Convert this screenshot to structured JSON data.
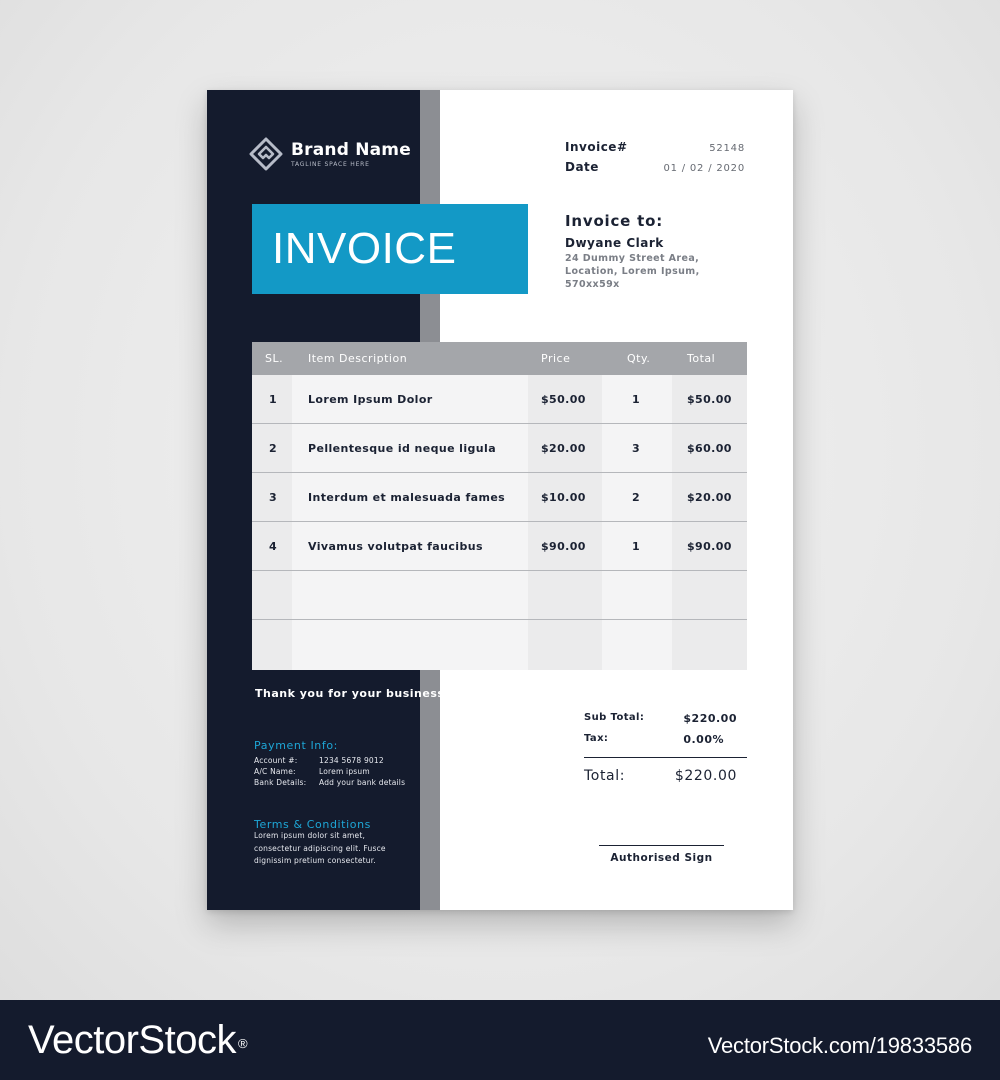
{
  "brand": {
    "name": "Brand Name",
    "tagline": "TAGLINE SPACE HERE"
  },
  "banner": {
    "title": "INVOICE"
  },
  "meta": {
    "invoice_label": "Invoice#",
    "invoice_number": "52148",
    "date_label": "Date",
    "date_value": "01 / 02 / 2020"
  },
  "recipient": {
    "title": "Invoice to:",
    "name": "Dwyane Clark",
    "address_lines": [
      "24 Dummy Street Area,",
      "Location, Lorem Ipsum,",
      "570xx59x"
    ]
  },
  "table": {
    "headers": [
      "SL.",
      "Item Description",
      "Price",
      "Qty.",
      "Total"
    ],
    "rows": [
      {
        "sl": "1",
        "desc": "Lorem Ipsum Dolor",
        "price": "$50.00",
        "qty": "1",
        "total": "$50.00"
      },
      {
        "sl": "2",
        "desc": "Pellentesque id neque ligula",
        "price": "$20.00",
        "qty": "3",
        "total": "$60.00"
      },
      {
        "sl": "3",
        "desc": "Interdum et malesuada fames",
        "price": "$10.00",
        "qty": "2",
        "total": "$20.00"
      },
      {
        "sl": "4",
        "desc": "Vivamus volutpat faucibus",
        "price": "$90.00",
        "qty": "1",
        "total": "$90.00"
      },
      {
        "sl": "",
        "desc": "",
        "price": "",
        "qty": "",
        "total": ""
      },
      {
        "sl": "",
        "desc": "",
        "price": "",
        "qty": "",
        "total": ""
      }
    ]
  },
  "sidebar": {
    "thanks": "Thank you for your business",
    "payment_title": "Payment Info:",
    "payment": [
      {
        "k": "Account #:",
        "v": "1234 5678 9012"
      },
      {
        "k": "A/C Name:",
        "v": "Lorem ipsum"
      },
      {
        "k": "Bank Details:",
        "v": "Add your bank details"
      }
    ],
    "terms_title": "Terms & Conditions",
    "terms_lines": [
      "Lorem ipsum dolor sit amet,",
      "consectetur adipiscing elit. Fusce",
      "dignissim pretium consectetur."
    ]
  },
  "summary": {
    "subtotal_label": "Sub Total:",
    "subtotal_value": "$220.00",
    "tax_label": "Tax:",
    "tax_value": "0.00%",
    "total_label": "Total:",
    "total_value": "$220.00",
    "sign_label": "Authorised Sign"
  },
  "footer": {
    "logo_text": "VectorStock",
    "logo_mark": "®",
    "image_id": "VectorStock.com/19833586"
  },
  "colors": {
    "sidebar": "#141b2d",
    "accent": "#1399c6",
    "stripe": "#8c8e93",
    "table_header": "#a4a6aa"
  }
}
